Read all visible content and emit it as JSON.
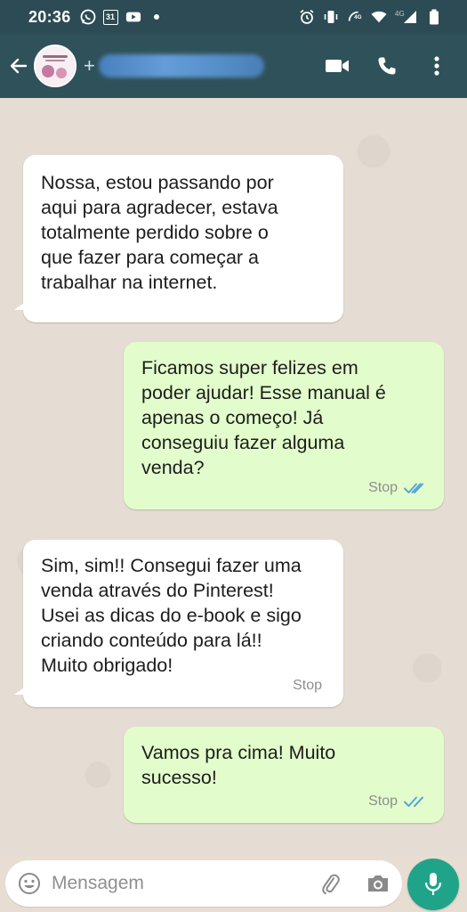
{
  "status_bar": {
    "time": "20:36",
    "calendar_day": "31",
    "network_label": "4G",
    "network_label_2": "4G"
  },
  "header": {
    "contact_prefix": "+",
    "contact_name_redacted": ""
  },
  "messages": [
    {
      "direction": "incoming",
      "text": "Nossa, estou passando por\naqui para agradecer, estava\ntotalmente perdido sobre o\nque fazer para começar a\ntrabalhar na internet.",
      "time": ""
    },
    {
      "direction": "outgoing",
      "text": "Ficamos super felizes em\npoder ajudar! Esse manual é\napenas o começo! Já\nconseguiu fazer alguma\nvenda?",
      "time": "Stop",
      "status": "read"
    },
    {
      "direction": "incoming",
      "text": "Sim, sim!! Consegui fazer uma\nvenda através do Pinterest!\nUsei as dicas do e-book e sigo\ncriando conteúdo para lá!!\nMuito obrigado!",
      "time": "Stop"
    },
    {
      "direction": "outgoing",
      "text": "Vamos pra cima! Muito\nsucesso!",
      "time": "Stop",
      "status": "read"
    }
  ],
  "composer": {
    "placeholder": "Mensagem"
  },
  "colors": {
    "status_bar": "#2c4b54",
    "app_bar": "#2f5159",
    "chat_bg": "#e5dcd3",
    "outgoing_bubble": "#e2fdcb",
    "incoming_bubble": "#ffffff",
    "read_ticks": "#5aa6d6",
    "mic_button": "#1fa48a"
  },
  "icons": {
    "status_left": [
      "whatsapp-icon",
      "calendar-icon",
      "youtube-icon",
      "notification-dot-icon"
    ],
    "status_right": [
      "alarm-icon",
      "vibrate-icon",
      "volte-icon",
      "wifi-icon",
      "signal-icon",
      "battery-icon"
    ],
    "header_actions": [
      "video-call-icon",
      "voice-call-icon",
      "more-vert-icon"
    ],
    "composer": [
      "emoji-icon",
      "attach-icon",
      "camera-icon",
      "mic-icon"
    ]
  }
}
